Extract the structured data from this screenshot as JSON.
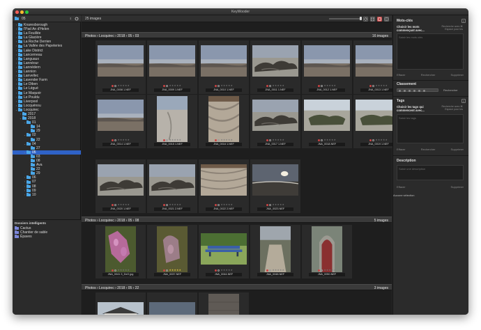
{
  "window": {
    "title": "KeyWooder"
  },
  "sidebar": {
    "selector_label": "05",
    "tree": [
      {
        "label": "Knaresborough",
        "depth": 0,
        "chev": "›"
      },
      {
        "label": "l'Pad An d'Helen",
        "depth": 0,
        "chev": "›"
      },
      {
        "label": "La Feuillée",
        "depth": 0,
        "chev": "›"
      },
      {
        "label": "La Glacière",
        "depth": 0,
        "chev": "›"
      },
      {
        "label": "La Roche Derrien",
        "depth": 0,
        "chev": "›"
      },
      {
        "label": "La Vallée des Papeteries",
        "depth": 0,
        "chev": "›"
      },
      {
        "label": "Lake District",
        "depth": 0,
        "chev": "›"
      },
      {
        "label": "Lancerneau",
        "depth": 0,
        "chev": "›"
      },
      {
        "label": "Languaux",
        "depth": 0,
        "chev": "›"
      },
      {
        "label": "Lannéour",
        "depth": 0,
        "chev": "›"
      },
      {
        "label": "Lannédern",
        "depth": 0,
        "chev": "›"
      },
      {
        "label": "Lannion",
        "depth": 0,
        "chev": "›"
      },
      {
        "label": "Lanvellec",
        "depth": 0,
        "chev": "›"
      },
      {
        "label": "Lavender Farm",
        "depth": 0,
        "chev": "›"
      },
      {
        "label": "Le Diben",
        "depth": 0,
        "chev": "›"
      },
      {
        "label": "Le Légué",
        "depth": 0,
        "chev": "›"
      },
      {
        "label": "Le Maquoir",
        "depth": 0,
        "chev": "›"
      },
      {
        "label": "Le Pouldu",
        "depth": 0,
        "chev": "›"
      },
      {
        "label": "Liverpool",
        "depth": 0,
        "chev": "›"
      },
      {
        "label": "Locquénou",
        "depth": 0,
        "chev": "›"
      },
      {
        "label": "Locquirec",
        "depth": 0,
        "chev": "⌄"
      },
      {
        "label": "2017",
        "depth": 1,
        "chev": "›"
      },
      {
        "label": "2018",
        "depth": 1,
        "chev": "⌄"
      },
      {
        "label": "01",
        "depth": 2,
        "chev": "⌄"
      },
      {
        "label": "14",
        "depth": 3,
        "chev": ""
      },
      {
        "label": "29",
        "depth": 3,
        "chev": ""
      },
      {
        "label": "02",
        "depth": 2,
        "chev": "⌄"
      },
      {
        "label": "22",
        "depth": 3,
        "chev": ""
      },
      {
        "label": "04",
        "depth": 2,
        "chev": "⌄"
      },
      {
        "label": "27",
        "depth": 3,
        "chev": ""
      },
      {
        "label": "05",
        "depth": 2,
        "chev": "⌄",
        "selected": true
      },
      {
        "label": "03",
        "depth": 3,
        "chev": ""
      },
      {
        "label": "08",
        "depth": 3,
        "chev": ""
      },
      {
        "label": "Ava",
        "depth": 3,
        "chev": ""
      },
      {
        "label": "22",
        "depth": 3,
        "chev": ""
      },
      {
        "label": "29",
        "depth": 3,
        "chev": ""
      },
      {
        "label": "06",
        "depth": 2,
        "chev": "›"
      },
      {
        "label": "07",
        "depth": 2,
        "chev": "›"
      },
      {
        "label": "08",
        "depth": 2,
        "chev": "›"
      },
      {
        "label": "09",
        "depth": 2,
        "chev": "›"
      },
      {
        "label": "10",
        "depth": 2,
        "chev": "›"
      }
    ],
    "smart_title": "Dossiers intelligents",
    "smart_folders": [
      "Cactus",
      "Chantier de sable",
      "Épaves"
    ]
  },
  "toolbar": {
    "count": "25 images"
  },
  "sections": [
    {
      "path": "Photos › Locquirec › 2018 › 05 › 03",
      "count": "16 images"
    },
    {
      "path": "Photos › Locquirec › 2018 › 05 › 08",
      "count": "5 images"
    },
    {
      "path": "Photos › Locquirec › 2018 › 05 › 22",
      "count": "3 images"
    }
  ],
  "images": [
    {
      "name": "JNA_0008 1.NEF",
      "kind": "sea",
      "stars": 0
    },
    {
      "name": "JNA_0009 1.NEF",
      "kind": "sea",
      "stars": 0
    },
    {
      "name": "JNA_0010 1.NEF",
      "kind": "sea",
      "stars": 0
    },
    {
      "name": "JNA_0011 1.NEF",
      "kind": "rocks",
      "stars": 0
    },
    {
      "name": "JNA_0012 1.NEF",
      "kind": "sea",
      "stars": 0
    },
    {
      "name": "JNA_0013 1.NEF",
      "kind": "sea",
      "stars": 0
    },
    {
      "name": "JNA_0014 1.NEF",
      "kind": "sea",
      "stars": 0
    },
    {
      "name": "JNA_0015 1.NEF",
      "kind": "beach",
      "stars": 0
    },
    {
      "name": "JNA_0016 1.NEF",
      "kind": "sand",
      "stars": 0
    },
    {
      "name": "JNA_0017 1.NEF",
      "kind": "rocks",
      "stars": 0
    },
    {
      "name": "JNA_0018.NEF",
      "kind": "moss",
      "stars": 0
    },
    {
      "name": "JNA_0019 1.NEF",
      "kind": "moss",
      "stars": 0
    },
    {
      "name": "JNA_0020 1.NEF",
      "kind": "rocks",
      "stars": 0
    },
    {
      "name": "JNA_0021 2.NEF",
      "kind": "rocks",
      "stars": 0
    },
    {
      "name": "JNA_0022 2.NEF",
      "kind": "sand",
      "stars": 0
    },
    {
      "name": "JNA_0023.NEF",
      "kind": "sunset",
      "stars": 0
    },
    {
      "name": "JNA_0041 3_DxO.jpg",
      "kind": "flowers",
      "stars": 0
    },
    {
      "name": "JNA_0037.NEF",
      "kind": "flowers2",
      "stars": 5
    },
    {
      "name": "JNA_0044.NEF",
      "kind": "bench",
      "stars": 0
    },
    {
      "name": "JNA_0048.NEF",
      "kind": "path",
      "stars": 0
    },
    {
      "name": "JNA_0050.NEF",
      "kind": "door",
      "stars": 0
    },
    {
      "name": "",
      "kind": "house",
      "stars": 0
    },
    {
      "name": "",
      "kind": "sky",
      "stars": 0
    },
    {
      "name": "",
      "kind": "wall",
      "stars": 0
    }
  ],
  "right_panel": {
    "keywords_title": "Mots-clés",
    "keywords_label": "Choisir les mots commençant avec...",
    "keywords_hint": "Recherche avec ⌘ Espace pour les",
    "keywords_placeholder": "Saisir les mots clés",
    "btn_clear": "Effacer",
    "btn_search": "Rechercher",
    "btn_delete": "Supprimer",
    "rating_title": "Classement",
    "rating_search": "Rechercher",
    "tags_title": "Tags",
    "tags_label": "Choisir les tags qui commencent avec...",
    "tags_hint": "Recherche avec ⌘ Espace pour les",
    "tags_placeholder": "Saisir les tags",
    "desc_title": "Description",
    "desc_placeholder": "Saisir une description",
    "no_selection": "Aucune sélection"
  }
}
